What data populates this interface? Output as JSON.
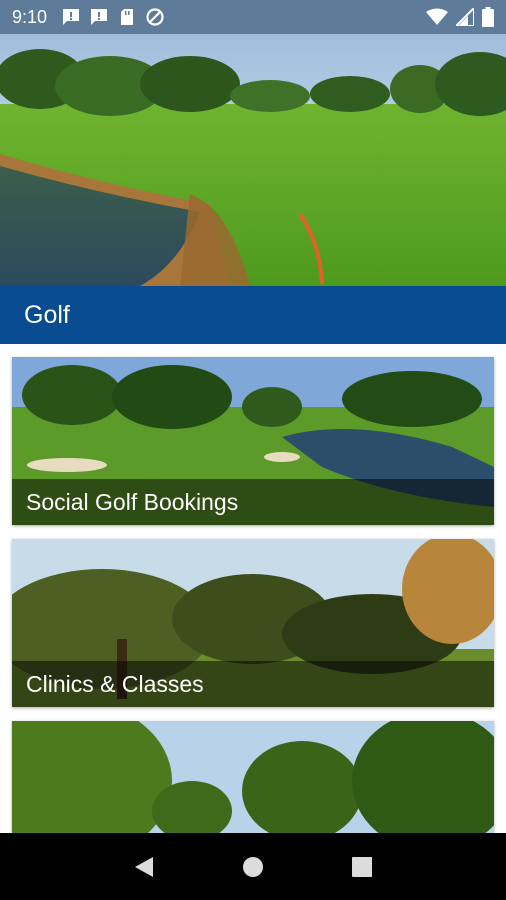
{
  "status_bar": {
    "time": "9:10",
    "left_icons": [
      "message-icon",
      "message-icon",
      "sd-card-icon",
      "data-saver-icon"
    ],
    "right_icons": [
      "wifi-icon",
      "signal-icon",
      "battery-icon"
    ]
  },
  "section": {
    "title": "Golf"
  },
  "cards": [
    {
      "label": "Social Golf Bookings"
    },
    {
      "label": "Clinics & Classes"
    },
    {
      "label": ""
    }
  ],
  "nav": {
    "buttons": [
      "back-icon",
      "home-icon",
      "recents-icon"
    ]
  },
  "colors": {
    "section_bar": "#0a4c91",
    "status_bar": "#5e7b9a",
    "nav_bar": "#000000"
  }
}
